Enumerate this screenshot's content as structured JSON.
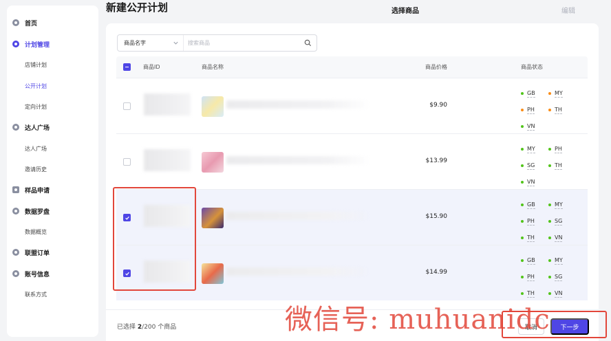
{
  "sidebar": {
    "items": [
      {
        "label": "首页",
        "icon": "home-icon"
      },
      {
        "label": "计划管理",
        "icon": "plan-icon"
      },
      {
        "label": "店铺计划"
      },
      {
        "label": "公开计划"
      },
      {
        "label": "定向计划"
      },
      {
        "label": "达人广场",
        "icon": "influencer-icon"
      },
      {
        "label": "达人广场"
      },
      {
        "label": "邀请历史"
      },
      {
        "label": "样品申请",
        "icon": "sample-icon"
      },
      {
        "label": "数据罗盘",
        "icon": "compass-icon"
      },
      {
        "label": "数据概览"
      },
      {
        "label": "联盟订单",
        "icon": "order-icon"
      },
      {
        "label": "账号信息",
        "icon": "account-icon"
      },
      {
        "label": "联系方式"
      }
    ]
  },
  "header": {
    "title": "新建公开计划",
    "step_current": "选择商品",
    "step_next": "编辑"
  },
  "search": {
    "field_label": "商品名字",
    "placeholder": "搜索商品"
  },
  "table": {
    "columns": {
      "id": "商品ID",
      "name": "商品名称",
      "price": "商品价格",
      "status": "商品状态"
    },
    "rows": [
      {
        "price": "$9.90",
        "selected": false,
        "regions": [
          [
            "GB",
            "green"
          ],
          [
            "MY",
            "orange"
          ],
          [
            "PH",
            "orange"
          ],
          [
            "TH",
            "orange"
          ],
          [
            "VN",
            "green"
          ]
        ]
      },
      {
        "price": "$13.99",
        "selected": false,
        "regions": [
          [
            "MY",
            "green"
          ],
          [
            "PH",
            "green"
          ],
          [
            "SG",
            "green"
          ],
          [
            "TH",
            "green"
          ],
          [
            "VN",
            "green"
          ]
        ]
      },
      {
        "price": "$15.90",
        "selected": true,
        "regions": [
          [
            "GB",
            "green"
          ],
          [
            "MY",
            "green"
          ],
          [
            "PH",
            "green"
          ],
          [
            "SG",
            "green"
          ],
          [
            "TH",
            "green"
          ],
          [
            "VN",
            "green"
          ]
        ]
      },
      {
        "price": "$14.99",
        "selected": true,
        "regions": [
          [
            "GB",
            "green"
          ],
          [
            "MY",
            "green"
          ],
          [
            "PH",
            "green"
          ],
          [
            "SG",
            "green"
          ],
          [
            "TH",
            "green"
          ],
          [
            "VN",
            "green"
          ]
        ]
      }
    ]
  },
  "footer": {
    "count_prefix": "已选择",
    "count_selected": "2",
    "count_total": "/200 个商品",
    "cancel_label": "取消",
    "next_label": "下一步"
  },
  "watermark": "微信号: muhuanidc",
  "colors": {
    "accent": "#4f46e5",
    "green": "#52c41a",
    "orange": "#fa8c16",
    "highlight": "#e2463a"
  }
}
